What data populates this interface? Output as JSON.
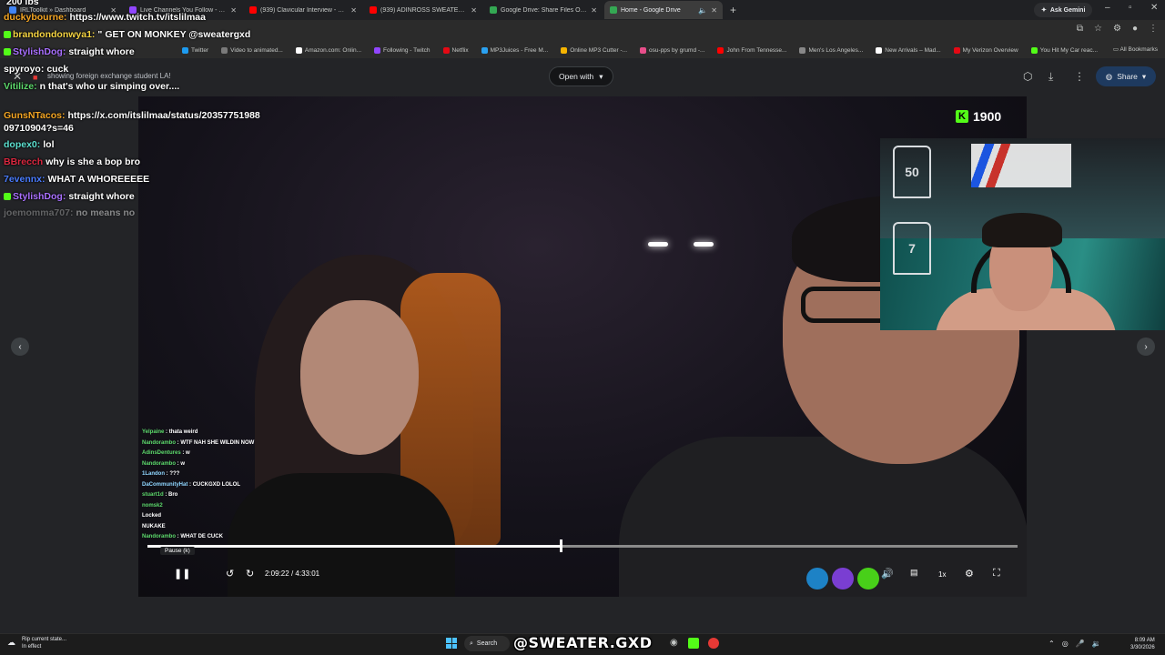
{
  "browser": {
    "tabs": [
      {
        "title": "IRLToolkit » Dashboard",
        "color": "#4285f4"
      },
      {
        "title": "Live Channels You Follow - Twitch",
        "color": "#9146ff"
      },
      {
        "title": "(939) Clavicular Interview - YouTube",
        "color": "#ff0000"
      },
      {
        "title": "(939) ADINROSS SWEATERGXD",
        "color": "#ff0000"
      },
      {
        "title": "Google Drive: Share Files Online",
        "color": "#34a853"
      },
      {
        "title": "Home - Google Drive",
        "color": "#34a853"
      }
    ],
    "gemini_label": "Ask Gemini",
    "bookmarks": [
      {
        "label": "Twitter",
        "color": "#1d9bf0"
      },
      {
        "label": "Video to animated...",
        "color": "#7a7a7a"
      },
      {
        "label": "Amazon.com: Onlin...",
        "color": "#ffffff"
      },
      {
        "label": "Following - Twitch",
        "color": "#9146ff"
      },
      {
        "label": "Netflix",
        "color": "#e50914"
      },
      {
        "label": "MP3Juices - Free M...",
        "color": "#2aa1f0"
      },
      {
        "label": "Online MP3 Cutter -...",
        "color": "#f6b400"
      },
      {
        "label": "osu-pps by grumd -...",
        "color": "#e84e8a"
      },
      {
        "label": "John From Tennesse...",
        "color": "#ff0000"
      },
      {
        "label": "Men's Los Angeles...",
        "color": "#888888"
      },
      {
        "label": "New Arrivals – Mad...",
        "color": "#ffffff"
      },
      {
        "label": "My Verizon Overview",
        "color": "#e50914"
      },
      {
        "label": "You Hit My Car reac...",
        "color": "#53fc18"
      }
    ],
    "all_bookmarks": "All Bookmarks"
  },
  "viewer": {
    "filename": "showing foreign exchange student LA!",
    "open_with": "Open with",
    "share": "Share"
  },
  "video": {
    "kick_viewers": "1900",
    "webcam_jerseys": [
      "50",
      "7"
    ],
    "ingame_chat": [
      {
        "user": "Yelpaine",
        "text": "thata weird"
      },
      {
        "user": "Nandorambo",
        "text": "WTF NAH SHE WILDIN NOW"
      },
      {
        "user": "AdinsDentures",
        "text": "w"
      },
      {
        "user": "Nandorambo",
        "text": "w"
      },
      {
        "user": "1Landon",
        "text": "???"
      },
      {
        "user": "DaCommunityHat",
        "text": "CUCKGXD LOLOL"
      },
      {
        "user": "stuart1d",
        "text": "Bro"
      },
      {
        "user": "nomsk2",
        "text": ""
      },
      {
        "user": "",
        "text": "Locked"
      },
      {
        "user": "",
        "text": "NUKAKE"
      },
      {
        "user": "Nandorambo",
        "text": "WHAT DE CUCK"
      }
    ],
    "progress": 0.475,
    "tooltip": "Pause (k)",
    "time_current": "2:09:22",
    "time_separator": "/",
    "time_total": "4:33:01",
    "speed": "1x"
  },
  "chat": [
    {
      "user": "",
      "text": "200 lbs",
      "user_color": "#ffffff"
    },
    {
      "user": "duckybourne:",
      "text": "https://www.twitch.tv/itslilmaa",
      "user_color": "#f5a623"
    },
    {
      "user": "brandondonwya1:",
      "text": "\" GET ON MONKEY @sweatergxd",
      "user_color": "#f5d442"
    },
    {
      "user": "StylishDog:",
      "text": "straight whore",
      "user_color": "#a970ff"
    },
    {
      "user": "spyroyo:",
      "text": "cuck",
      "user_color": "#ffffff"
    },
    {
      "user": "Vitilize:",
      "text": "n that's who ur simping over....",
      "user_color": "#5cd96b"
    },
    {
      "user": "GunsNTacos:",
      "text": "https://x.com/itslilmaa/status/20357751988",
      "user_color": "#f5a623"
    },
    {
      "user": "",
      "text": "09710904?s=46",
      "user_color": "#ffffff"
    },
    {
      "user": "dopex0:",
      "text": "lol",
      "user_color": "#5ce0d0"
    },
    {
      "user": "BBrecch",
      "text": "why is she a bop bro",
      "user_color": "#d9273f"
    },
    {
      "user": "7evennx:",
      "text": "WHAT A WHOREEEEE",
      "user_color": "#4a7dff"
    },
    {
      "user": "StylishDog:",
      "text": "straight whore",
      "user_color": "#a970ff"
    },
    {
      "user": "joemomma707:",
      "text": "no means no",
      "user_color": "#777777"
    }
  ],
  "taskbar": {
    "notice_title": "Rip current state...",
    "notice_sub": "In effect",
    "search": "Search",
    "brand": "@SWEATER.GXD",
    "time": "8:09 AM",
    "date": "3/30/2026"
  },
  "colors": {
    "accent": "#53fc18",
    "share": "#1e3a5f"
  }
}
